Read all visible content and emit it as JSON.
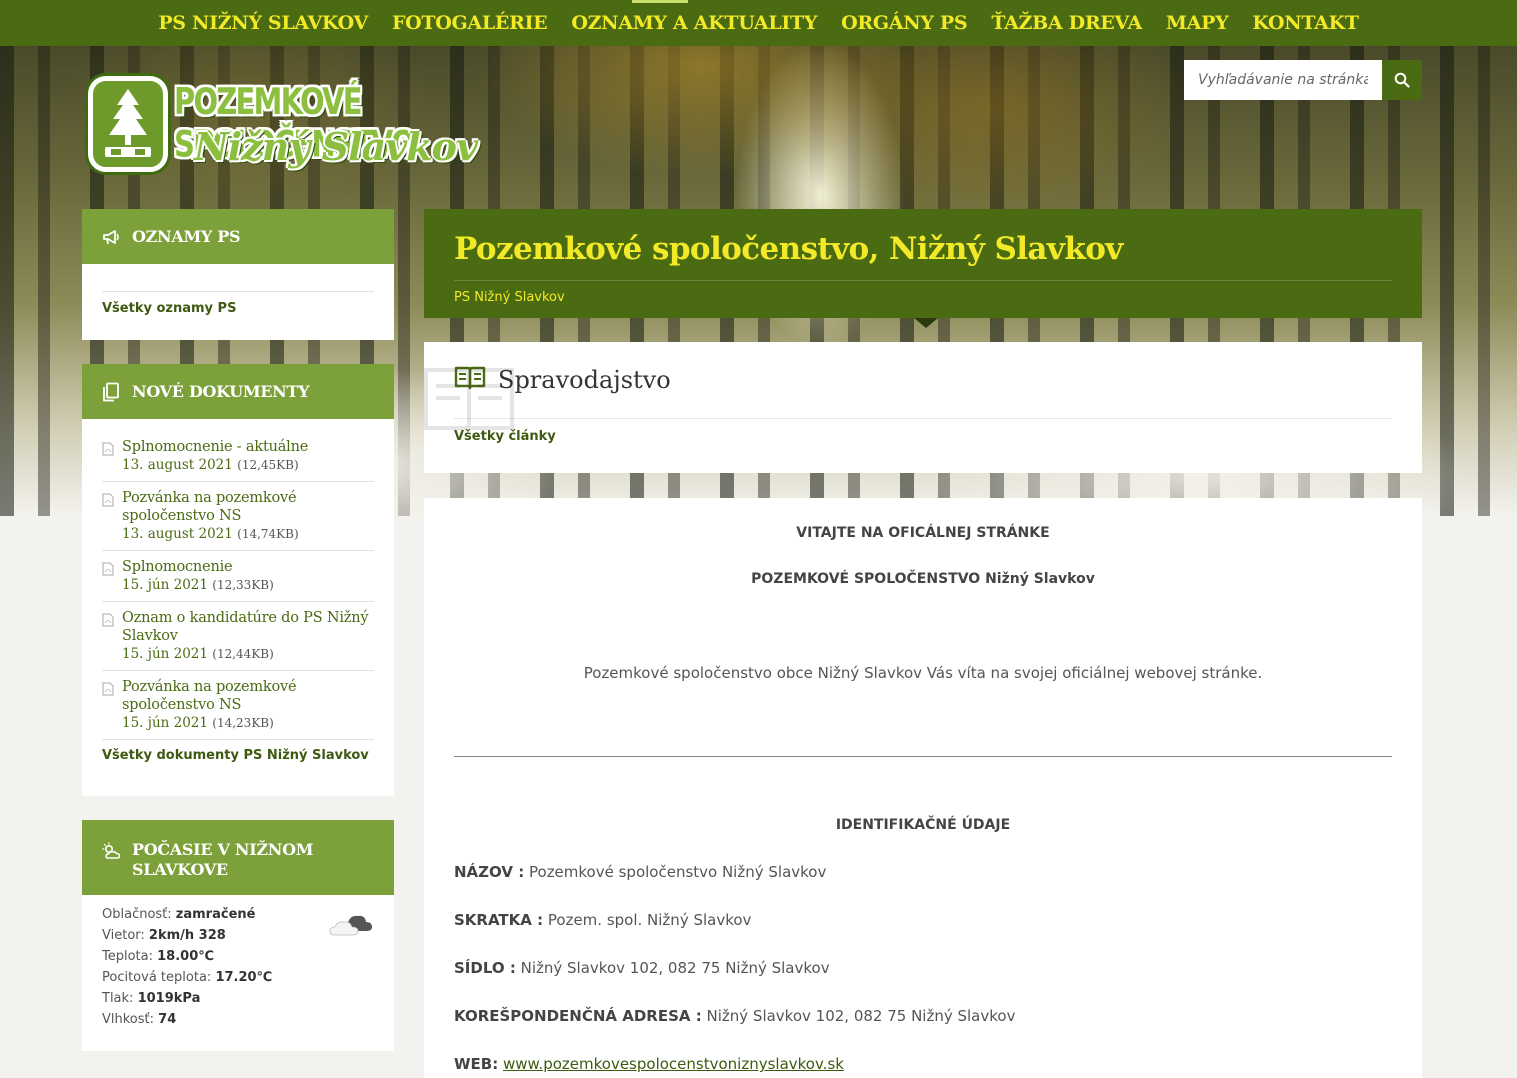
{
  "nav": {
    "items": [
      "PS NIŽNÝ SLAVKOV",
      "FOTOGALÉRIE",
      "OZNAMY A AKTUALITY",
      "ORGÁNY PS",
      "ŤAŽBA DREVA",
      "MAPY",
      "KONTAKT"
    ]
  },
  "logo": {
    "line1": "POZEMKOVÉ SPOLOČENSTVO",
    "line2": "Nižný Slavkov"
  },
  "search": {
    "placeholder": "Vyhľadávanie na stránkach",
    "icon": "search-icon"
  },
  "sidebar": {
    "oznamy": {
      "title": "OZNAMY PS",
      "icon": "megaphone-icon",
      "link": "Všetky oznamy PS"
    },
    "dokumenty": {
      "title": "NOVÉ DOKUMENTY",
      "icon": "documents-icon",
      "items": [
        {
          "title": "Splnomocnenie - aktuálne",
          "date": "13. august 2021",
          "size": "(12,45KB)"
        },
        {
          "title": "Pozvánka na pozemkové spoločenstvo NS",
          "date": "13. august 2021",
          "size": "(14,74KB)"
        },
        {
          "title": "Splnomocnenie",
          "date": "15. jún 2021",
          "size": "(12,33KB)"
        },
        {
          "title": "Oznam o kandidatúre do PS Nižný Slavkov",
          "date": "15. jún 2021",
          "size": "(12,44KB)"
        },
        {
          "title": "Pozvánka na pozemkové spoločenstvo NS",
          "date": "15. jún 2021",
          "size": "(14,23KB)"
        }
      ],
      "link": "Všetky dokumenty PS Nižný Slavkov"
    },
    "pocasie": {
      "title": "POČASIE V NIŽNOM SLAVKOVE",
      "icon": "weather-icon",
      "rows": [
        {
          "label": "Oblačnosť:",
          "value": "zamračené"
        },
        {
          "label": "Vietor:",
          "value": "2km/h 328"
        },
        {
          "label": "Teplota:",
          "value": "18.00℃"
        },
        {
          "label": "Pocitová teplota:",
          "value": "17.20℃"
        },
        {
          "label": "Tlak:",
          "value": "1019kPa"
        },
        {
          "label": "Vlhkosť:",
          "value": "74"
        }
      ]
    }
  },
  "hero": {
    "title": "Pozemkové spoločenstvo, Nižný Slavkov",
    "breadcrumb": "PS Nižný Slavkov"
  },
  "news": {
    "title": "Spravodajstvo",
    "link": "Všetky články"
  },
  "content": {
    "heading1": "VITAJTE NA OFICÁLNEJ STRÁNKE",
    "heading2": "POZEMKOVÉ SPOLOČENSTVO Nižný Slavkov",
    "welcome": "Pozemkové spoločenstvo obce Nižný Slavkov Vás víta na svojej oficiálnej webovej stránke.",
    "id_heading": "IDENTIFIKAČNÉ ÚDAJE",
    "fields": [
      {
        "label": "NÁZOV :",
        "value": "Pozemkové spoločenstvo Nižný Slavkov"
      },
      {
        "label": "SKRATKA :",
        "value": "Pozem. spol. Nižný Slavkov"
      },
      {
        "label": "SÍDLO :",
        "value": "Nižný Slavkov 102, 082 75 Nižný Slavkov"
      },
      {
        "label": "KOREŠPONDENČNÁ ADRESA :",
        "value": "Nižný Slavkov 102, 082 75 Nižný Slavkov"
      }
    ],
    "web_label": "WEB:",
    "web_url": "www.pozemkovespolocenstvoniznyslavkov.sk"
  },
  "colors": {
    "nav_bg": "#4b6b13",
    "nav_text": "#f2ea26",
    "widget_head": "#7da13a",
    "link": "#3e5a10"
  }
}
